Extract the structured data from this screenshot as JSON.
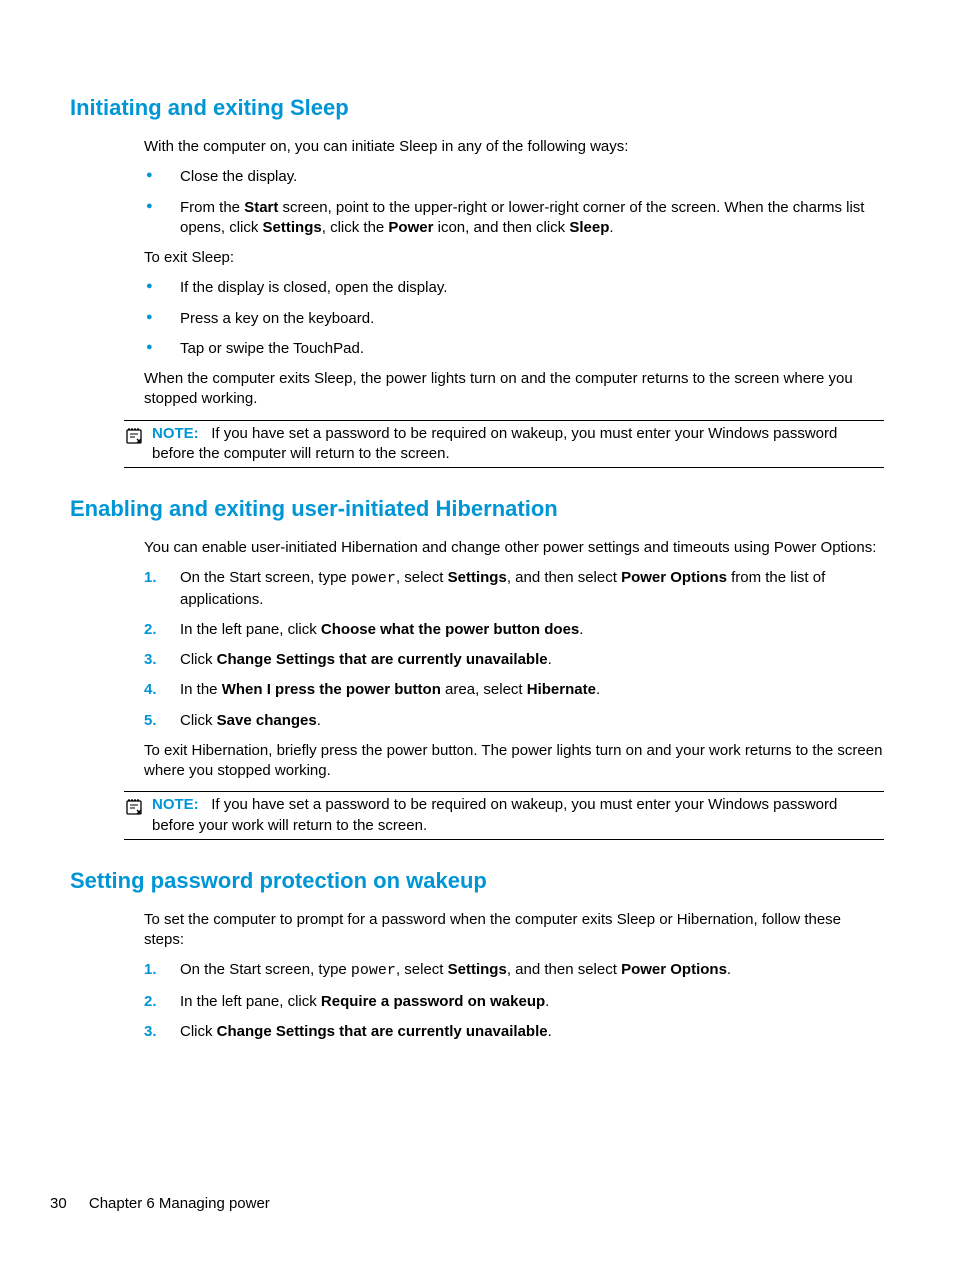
{
  "footer": {
    "page_number": "30",
    "chapter": "Chapter 6   Managing power"
  },
  "sections": [
    {
      "heading": "Initiating and exiting Sleep",
      "intro": "With the computer on, you can initiate Sleep in any of the following ways:",
      "bullets1": [
        "Close the display.",
        "From the <b>Start</b> screen, point to the upper-right or lower-right corner of the screen. When the charms list opens, click <b>Settings</b>, click the <b>Power</b> icon, and then click <b>Sleep</b>."
      ],
      "para2": "To exit Sleep:",
      "bullets2": [
        "If the display is closed, open the display.",
        "Press a key on the keyboard.",
        "Tap or swipe the TouchPad."
      ],
      "para3": "When the computer exits Sleep, the power lights turn on and the computer returns to the screen where you stopped working.",
      "note": {
        "label": "NOTE:",
        "text": "If you have set a password to be required on wakeup, you must enter your Windows password before the computer will return to the screen."
      }
    },
    {
      "heading": "Enabling and exiting user-initiated Hibernation",
      "intro": "You can enable user-initiated Hibernation and change other power settings and timeouts using Power Options:",
      "steps": [
        "On the Start screen, type <code class=\"mono\">power</code>, select <b>Settings</b>, and then select <b>Power Options</b> from the list of applications.",
        "In the left pane, click <b>Choose what the power button does</b>.",
        "Click <b>Change Settings that are currently unavailable</b>.",
        "In the <b>When I press the power button</b> area, select <b>Hibernate</b>.",
        "Click <b>Save changes</b>."
      ],
      "para2": "To exit Hibernation, briefly press the power button. The power lights turn on and your work returns to the screen where you stopped working.",
      "note": {
        "label": "NOTE:",
        "text": "If you have set a password to be required on wakeup, you must enter your Windows password before your work will return to the screen."
      }
    },
    {
      "heading": "Setting password protection on wakeup",
      "intro": "To set the computer to prompt for a password when the computer exits Sleep or Hibernation, follow these steps:",
      "steps": [
        "On the Start screen, type <code class=\"mono\">power</code>, select <b>Settings</b>, and then select <b>Power Options</b>.",
        "In the left pane, click <b>Require a password on wakeup</b>.",
        "Click <b>Change Settings that are currently unavailable</b>."
      ]
    }
  ]
}
